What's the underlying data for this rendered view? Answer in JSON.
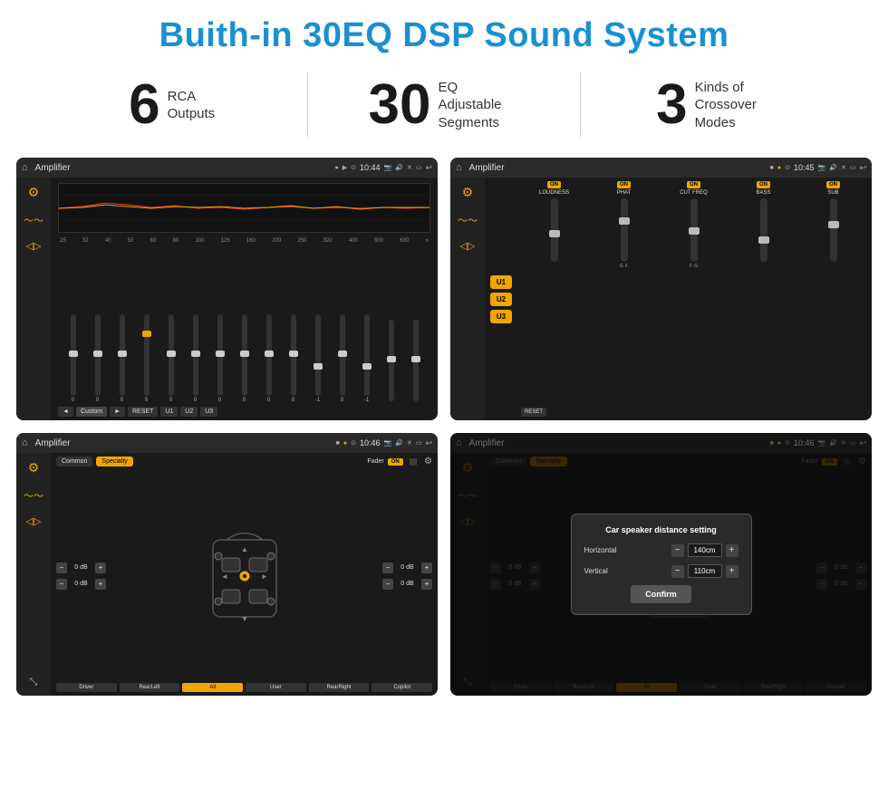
{
  "header": {
    "title": "Buith-in 30EQ DSP Sound System"
  },
  "stats": [
    {
      "number": "6",
      "label": "RCA\nOutputs"
    },
    {
      "number": "30",
      "label": "EQ Adjustable\nSegments"
    },
    {
      "number": "3",
      "label": "Kinds of\nCrossover Modes"
    }
  ],
  "screens": [
    {
      "id": "screen1",
      "status_bar": {
        "title": "Amplifier",
        "time": "10:44"
      },
      "type": "eq"
    },
    {
      "id": "screen2",
      "status_bar": {
        "title": "Amplifier",
        "time": "10:45"
      },
      "type": "amp2"
    },
    {
      "id": "screen3",
      "status_bar": {
        "title": "Amplifier",
        "time": "10:46"
      },
      "type": "speaker"
    },
    {
      "id": "screen4",
      "status_bar": {
        "title": "Amplifier",
        "time": "10:46"
      },
      "type": "speaker_dialog"
    }
  ],
  "eq": {
    "frequencies": [
      "25",
      "32",
      "40",
      "50",
      "63",
      "80",
      "100",
      "125",
      "160",
      "200",
      "250",
      "320",
      "400",
      "500",
      "630"
    ],
    "values": [
      "0",
      "0",
      "0",
      "5",
      "0",
      "0",
      "0",
      "0",
      "0",
      "0",
      "-1",
      "0",
      "-1",
      "",
      ""
    ],
    "preset": "Custom",
    "buttons": [
      "◄",
      "Custom",
      "►",
      "RESET",
      "U1",
      "U2",
      "U3"
    ]
  },
  "amp2": {
    "u_buttons": [
      "U1",
      "U2",
      "U3"
    ],
    "channels": [
      {
        "name": "LOUDNESS",
        "on": true
      },
      {
        "name": "PHAT",
        "on": true
      },
      {
        "name": "CUT FREQ",
        "on": true
      },
      {
        "name": "BASS",
        "on": true
      },
      {
        "name": "SUB",
        "on": true
      }
    ],
    "reset_label": "RESET"
  },
  "speaker": {
    "modes": [
      "Common",
      "Specialty"
    ],
    "fader_label": "Fader",
    "on_label": "ON",
    "db_values": [
      "0 dB",
      "0 dB",
      "0 dB",
      "0 dB"
    ],
    "bottom_btns": [
      "Driver",
      "RearLeft",
      "All",
      "User",
      "RearRight",
      "Copilot"
    ]
  },
  "dialog": {
    "title": "Car speaker distance setting",
    "horizontal_label": "Horizontal",
    "horizontal_value": "140cm",
    "vertical_label": "Vertical",
    "vertical_value": "110cm",
    "confirm_label": "Confirm"
  }
}
